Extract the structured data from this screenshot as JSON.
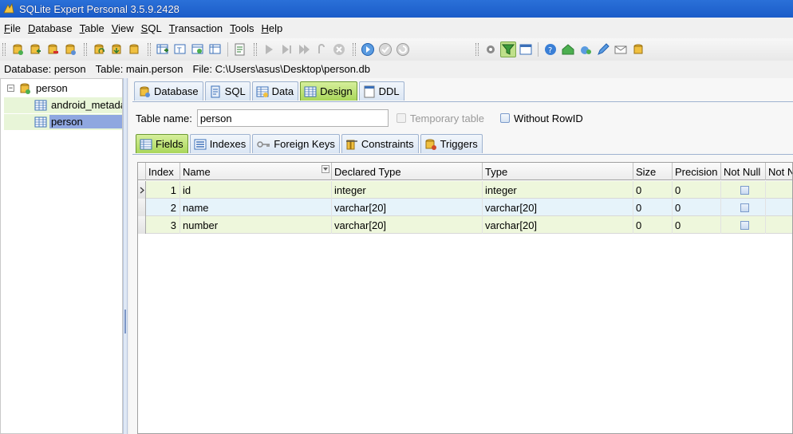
{
  "window": {
    "title": "SQLite Expert Personal 3.5.9.2428"
  },
  "menu": [
    "File",
    "Database",
    "Table",
    "View",
    "SQL",
    "Transaction",
    "Tools",
    "Help"
  ],
  "status": {
    "database": "Database: person",
    "table": "Table: main.person",
    "file": "File: C:\\Users\\asus\\Desktop\\person.db"
  },
  "tree": {
    "root": "person",
    "items": [
      "android_metadata",
      "person"
    ]
  },
  "main_tabs": [
    "Database",
    "SQL",
    "Data",
    "Design",
    "DDL"
  ],
  "active_main_tab": "Design",
  "design": {
    "table_name_label": "Table name:",
    "table_name_value": "person",
    "temporary_label": "Temporary table",
    "without_rowid_label": "Without RowID"
  },
  "sub_tabs": [
    "Fields",
    "Indexes",
    "Foreign Keys",
    "Constraints",
    "Triggers"
  ],
  "active_sub_tab": "Fields",
  "grid": {
    "columns": [
      "Index",
      "Name",
      "Declared Type",
      "Type",
      "Size",
      "Precision",
      "Not Null",
      "Not Null"
    ],
    "rows": [
      {
        "index": "1",
        "name": "id",
        "declared": "integer",
        "type": "integer",
        "size": "0",
        "precision": "0"
      },
      {
        "index": "2",
        "name": "name",
        "declared": "varchar[20]",
        "type": "varchar[20]",
        "size": "0",
        "precision": "0"
      },
      {
        "index": "3",
        "name": "number",
        "declared": "varchar[20]",
        "type": "varchar[20]",
        "size": "0",
        "precision": "0"
      }
    ]
  },
  "colors": {
    "accent_green": "#a9d65a",
    "selection_blue": "#8fa7e0",
    "row_alt": "#e6f3fa",
    "row_green": "#eef7dc"
  }
}
